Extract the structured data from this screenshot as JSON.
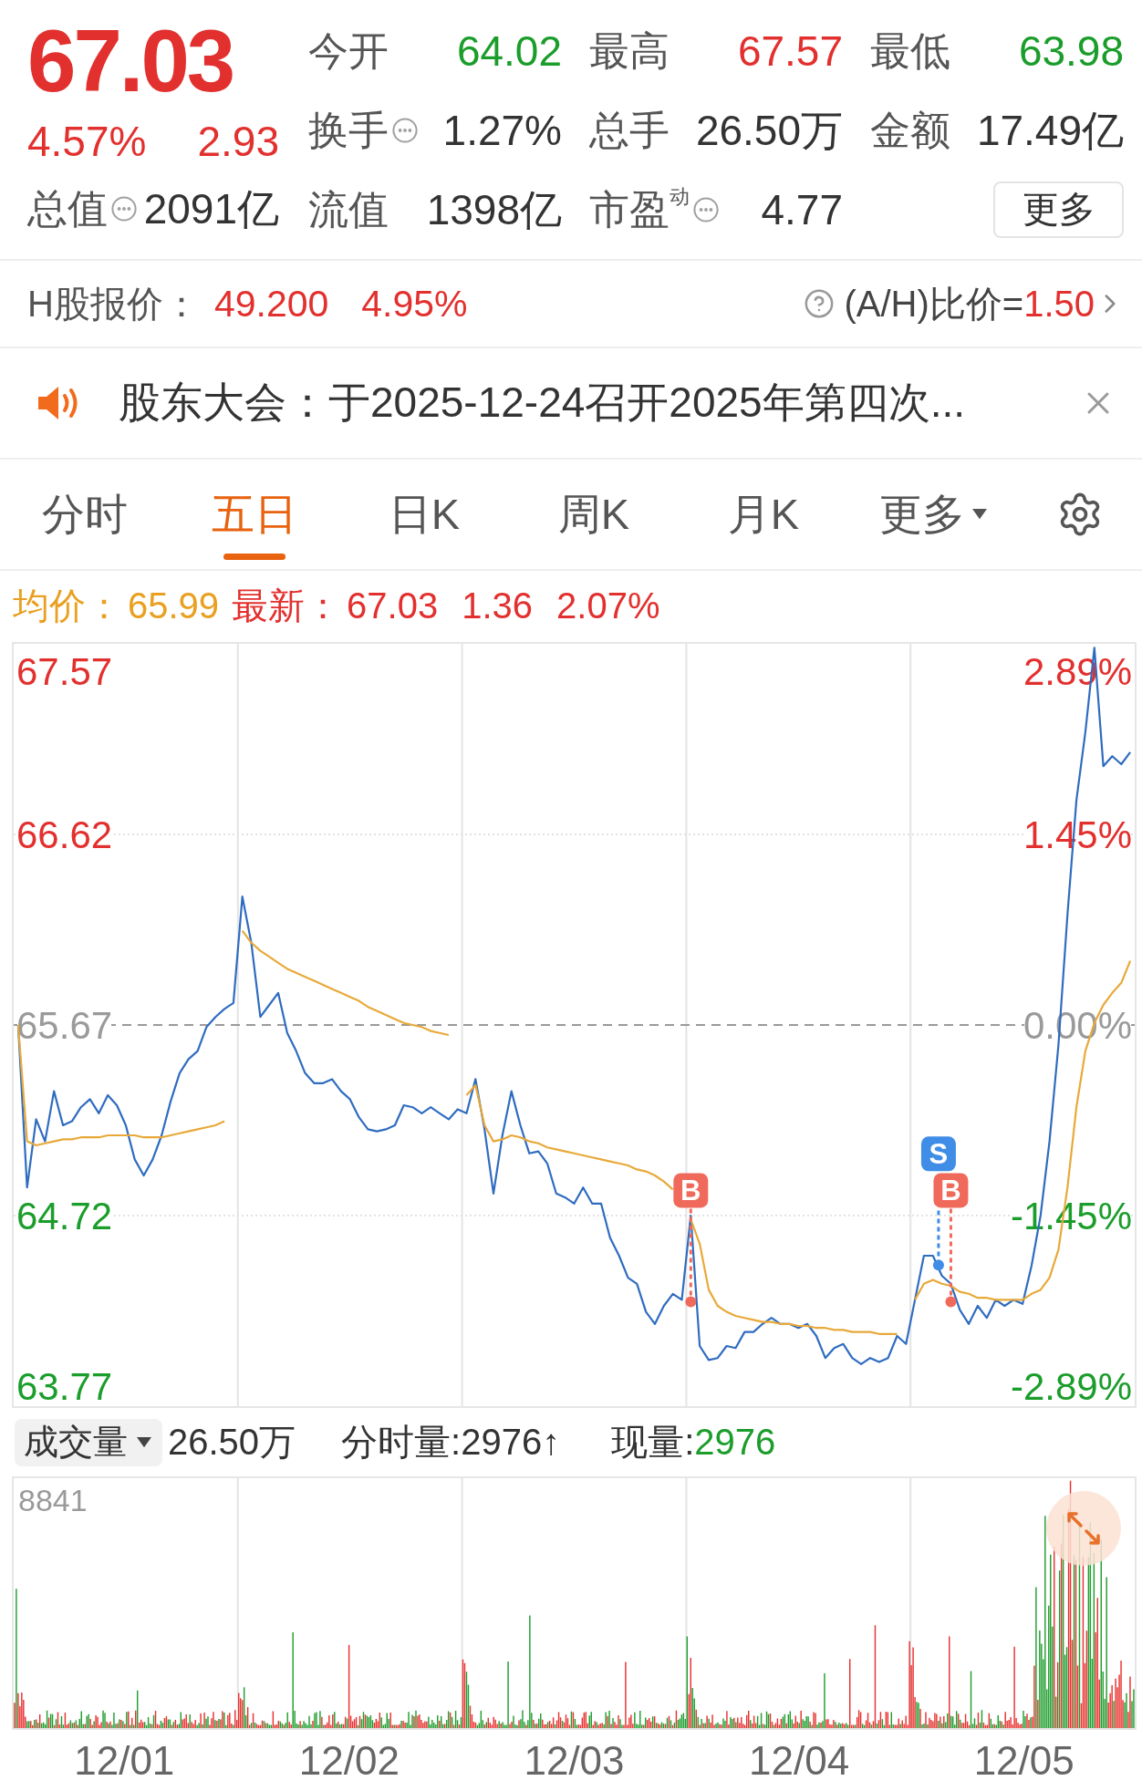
{
  "header": {
    "price": "67.03",
    "change_pct": "4.57%",
    "change": "2.93",
    "total_value": {
      "label": "总值",
      "info": true,
      "value": "2091亿"
    },
    "stats": [
      {
        "label": "今开",
        "info": false,
        "value": "64.02",
        "color": "#1b9d2b"
      },
      {
        "label": "最高",
        "info": false,
        "value": "67.57",
        "color": "#e2302e"
      },
      {
        "label": "最低",
        "info": false,
        "value": "63.98",
        "color": "#1b9d2b"
      },
      {
        "label": "换手",
        "info": true,
        "value": "1.27%",
        "color": "#333333"
      },
      {
        "label": "总手",
        "info": false,
        "value": "26.50万",
        "color": "#333333"
      },
      {
        "label": "金额",
        "info": false,
        "value": "17.49亿",
        "color": "#333333"
      },
      {
        "label": "流值",
        "info": false,
        "value": "1398亿",
        "color": "#333333"
      },
      {
        "label": "市盈$^{动}$",
        "info": true,
        "value": "4.77",
        "color": "#333333"
      }
    ],
    "more_button": "更多"
  },
  "h_share": {
    "label": "H股报价：",
    "price": "49.200",
    "change_pct": "4.95%",
    "ratio_label": "(A/H)比价=",
    "ratio_value": "1.50"
  },
  "notice": {
    "text": "股东大会：于2025-12-24召开2025年第四次..."
  },
  "tabs": [
    {
      "label": "分时",
      "selected": false,
      "kind": "tab"
    },
    {
      "label": "五日",
      "selected": true,
      "kind": "tab"
    },
    {
      "label": "日K",
      "selected": false,
      "kind": "tab"
    },
    {
      "label": "周K",
      "selected": false,
      "kind": "tab"
    },
    {
      "label": "月K",
      "selected": false,
      "kind": "tab"
    },
    {
      "label": "更多",
      "selected": false,
      "kind": "menu"
    }
  ],
  "summary": {
    "avg_label": "均价：",
    "avg_value": "65.99",
    "latest_label": "最新：",
    "latest_value": "67.03",
    "change": "1.36",
    "change_pct": "2.07%"
  },
  "price_chart": {
    "percent_labels": [
      "2.89%",
      "1.45%",
      "0.00%",
      "-1.45%",
      "-2.89%"
    ],
    "signals": [
      {
        "kind": "buy"
      },
      {
        "kind": "sell"
      },
      {
        "kind": "buy"
      }
    ],
    "chart_data": {
      "type": "line",
      "ylim": [
        63.77,
        67.57
      ],
      "grid": true,
      "yticks": [
        {
          "value": 67.57,
          "label": "67.57"
        },
        {
          "value": 66.62,
          "label": "66.62"
        },
        {
          "value": 65.67,
          "label": "65.67"
        },
        {
          "value": 64.72,
          "label": "64.72"
        },
        {
          "value": 63.77,
          "label": "63.77"
        }
      ],
      "ref_lines": [
        {
          "axis": "y",
          "value": 65.67
        }
      ],
      "series": [
        {
          "color": "#2f6cc0",
          "values": [
            65.67,
            64.86,
            65.2,
            65.09,
            65.34,
            65.17,
            65.19,
            65.26,
            65.3,
            65.23,
            65.32,
            65.27,
            65.17,
            65.0,
            64.92,
            65.0,
            65.12,
            65.29,
            65.43,
            65.5,
            65.54,
            65.66,
            65.71,
            65.75,
            65.78,
            66.31,
            66.08,
            65.71,
            65.77,
            65.83,
            65.63,
            65.54,
            65.43,
            65.38,
            65.38,
            65.4,
            65.34,
            65.3,
            65.21,
            65.15,
            65.14,
            65.15,
            65.17,
            65.27,
            65.26,
            65.23,
            65.26,
            65.23,
            65.2,
            65.25,
            65.23,
            65.4,
            65.15,
            64.83,
            65.12,
            65.34,
            65.17,
            65.03,
            65.04,
            64.98,
            64.83,
            64.81,
            64.78,
            64.86,
            64.78,
            64.78,
            64.61,
            64.52,
            64.41,
            64.38,
            64.24,
            64.18,
            64.27,
            64.33,
            64.3,
            64.72,
            64.07,
            64.0,
            64.01,
            64.07,
            64.06,
            64.14,
            64.14,
            64.18,
            64.21,
            64.18,
            64.18,
            64.16,
            64.18,
            64.12,
            64.01,
            64.06,
            64.08,
            64.01,
            63.98,
            64.01,
            63.99,
            64.01,
            64.12,
            64.08,
            64.3,
            64.52,
            64.52,
            64.42,
            64.38,
            64.25,
            64.18,
            64.27,
            64.21,
            64.3,
            64.27,
            64.3,
            64.28,
            64.47,
            64.72,
            65.09,
            65.57,
            66.22,
            66.79,
            67.13,
            67.55,
            66.96,
            67.01,
            66.97,
            67.03
          ]
        },
        {
          "color": "#e8a93a",
          "values": [
            65.67,
            65.09,
            65.07,
            65.08,
            65.09,
            65.1,
            65.1,
            65.11,
            65.11,
            65.11,
            65.12,
            65.12,
            65.12,
            65.12,
            65.11,
            65.11,
            65.11,
            65.12,
            65.13,
            65.14,
            65.15,
            65.16,
            65.17,
            65.19,
            null,
            66.14,
            66.08,
            66.04,
            66.01,
            65.98,
            65.95,
            65.93,
            65.91,
            65.89,
            65.87,
            65.85,
            65.83,
            65.81,
            65.79,
            65.76,
            65.74,
            65.72,
            65.7,
            65.68,
            65.67,
            65.66,
            65.64,
            65.63,
            65.62,
            null,
            65.32,
            65.37,
            65.17,
            65.09,
            65.1,
            65.12,
            65.11,
            65.09,
            65.08,
            65.06,
            65.05,
            65.04,
            65.03,
            65.02,
            65.01,
            65.0,
            64.99,
            64.98,
            64.97,
            64.95,
            64.94,
            64.92,
            64.89,
            64.85,
            null,
            64.7,
            64.58,
            64.35,
            64.27,
            64.24,
            64.22,
            64.21,
            64.2,
            64.19,
            64.19,
            64.18,
            64.18,
            64.17,
            64.17,
            64.16,
            64.16,
            64.15,
            64.15,
            64.14,
            64.14,
            64.14,
            64.13,
            64.13,
            64.13,
            null,
            64.3,
            64.38,
            64.4,
            64.38,
            64.37,
            64.34,
            64.33,
            64.31,
            64.31,
            64.3,
            64.3,
            64.3,
            64.3,
            64.33,
            64.35,
            64.41,
            64.55,
            64.86,
            65.26,
            65.54,
            65.68,
            65.77,
            65.83,
            65.88,
            65.99
          ]
        }
      ],
      "annotations": [
        "B",
        "S",
        "B"
      ]
    }
  },
  "volume": {
    "selector": "成交量",
    "total": "26.50万",
    "period_volume": "分时量:2976↑",
    "current_label": "现量:",
    "current_value": "2976",
    "max_label": "8841"
  },
  "date_axis": [
    "12/01",
    "12/02",
    "12/03",
    "12/04",
    "12/05"
  ]
}
